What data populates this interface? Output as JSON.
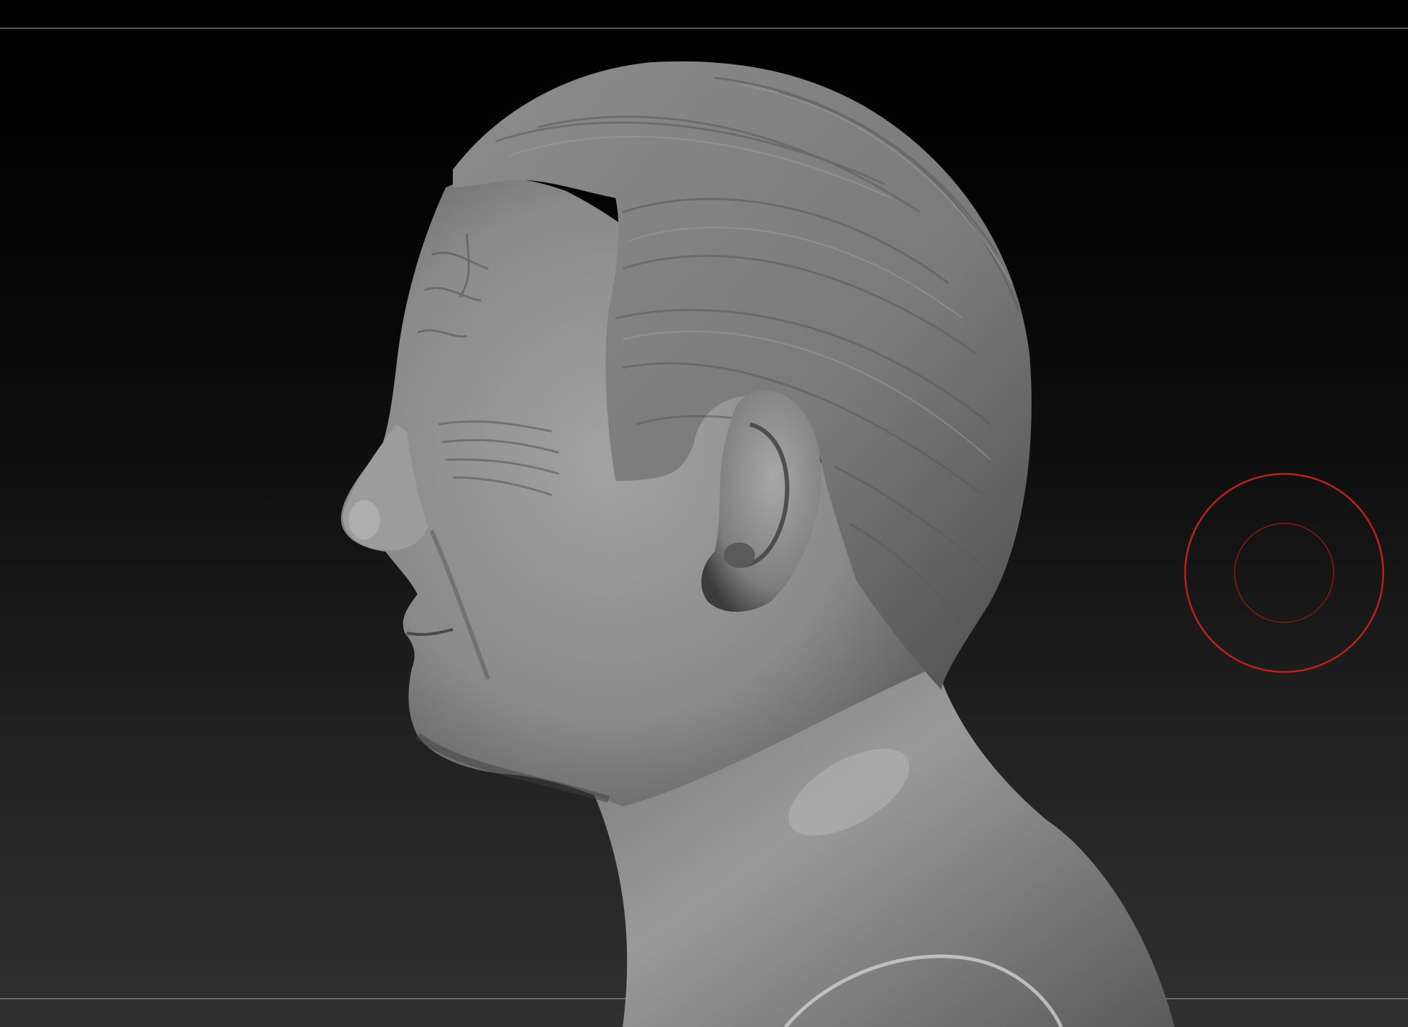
{
  "canvas": {
    "background_top": "#000000",
    "background_bottom": "#303030",
    "frame_line_color": "#5a5a5a"
  },
  "model": {
    "material_color": "#8a8a8a",
    "highlight_color": "#b4b4b4",
    "shadow_color": "#3a3a3a"
  },
  "brush_cursor": {
    "color": "#c0201a",
    "icon": "brush-draw-size-circle"
  }
}
